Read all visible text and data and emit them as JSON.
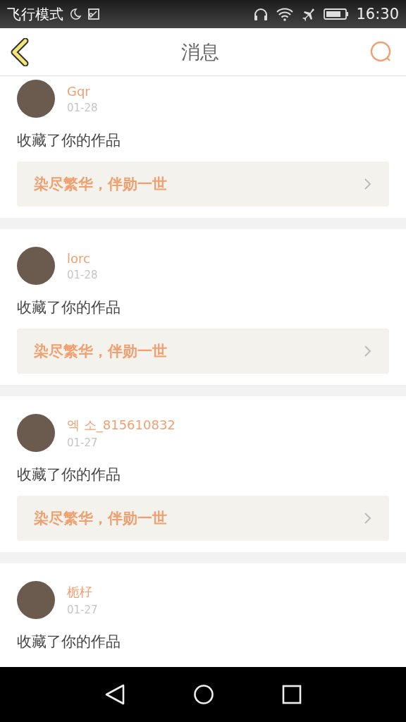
{
  "status_bar": {
    "mode_text": "飞行模式",
    "time": "16:30"
  },
  "header": {
    "title": "消息"
  },
  "messages": [
    {
      "user": "Gqr",
      "date": "01-28",
      "action": "收藏了你的作品",
      "work": "染尽繁华，伴勋一世"
    },
    {
      "user": "lorc",
      "date": "01-28",
      "action": "收藏了你的作品",
      "work": "染尽繁华，伴勋一世"
    },
    {
      "user": "엑 소_815610832",
      "date": "01-27",
      "action": "收藏了你的作品",
      "work": "染尽繁华，伴勋一世"
    },
    {
      "user": "栀杍",
      "date": "01-27",
      "action": "收藏了你的作品"
    }
  ]
}
